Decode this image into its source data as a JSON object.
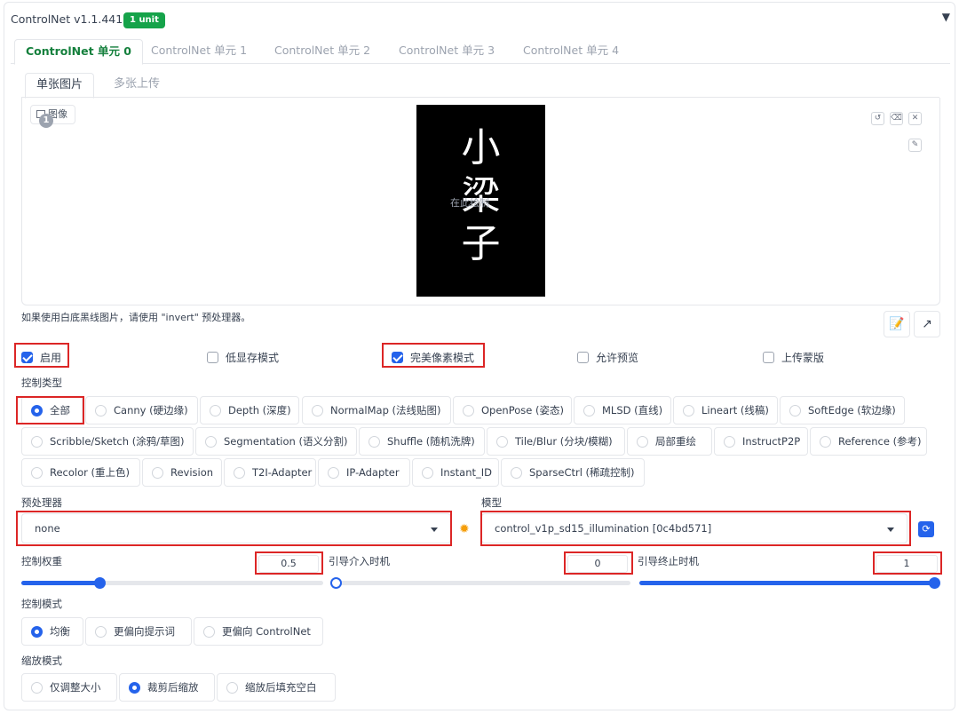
{
  "header": {
    "title": "ControlNet v1.1.441",
    "badge": "1 unit"
  },
  "tabs": [
    "ControlNet 单元 0",
    "ControlNet 单元 1",
    "ControlNet 单元 2",
    "ControlNet 单元 3",
    "ControlNet 单元 4"
  ],
  "subtabs": [
    "单张图片",
    "多张上传"
  ],
  "image": {
    "label": "图像",
    "number": "1",
    "characters": [
      "小",
      "梁",
      "子"
    ],
    "watermark": "在此绘制"
  },
  "hint": "如果使用白底黑线图片，请使用 \"invert\" 预处理器。",
  "options": {
    "enable": "启用",
    "low_vram": "低显存模式",
    "pixel_perfect": "完美像素模式",
    "allow_preview": "允许预览",
    "upload_mask": "上传蒙版"
  },
  "control_type": {
    "label": "控制类型",
    "rows": [
      [
        "全部",
        "Canny (硬边缘)",
        "Depth (深度)",
        "NormalMap (法线贴图)",
        "OpenPose (姿态)",
        "MLSD (直线)",
        "Lineart (线稿)",
        "SoftEdge (软边缘)"
      ],
      [
        "Scribble/Sketch (涂鸦/草图)",
        "Segmentation (语义分割)",
        "Shuffle (随机洗牌)",
        "Tile/Blur (分块/模糊)",
        "局部重绘",
        "InstructP2P",
        "Reference (参考)"
      ],
      [
        "Recolor (重上色)",
        "Revision",
        "T2I-Adapter",
        "IP-Adapter",
        "Instant_ID",
        "SparseCtrl (稀疏控制)"
      ]
    ],
    "selected": "全部"
  },
  "preprocessor": {
    "label": "预处理器",
    "value": "none"
  },
  "model": {
    "label": "模型",
    "value": "control_v1p_sd15_illumination [0c4bd571]"
  },
  "sliders": {
    "weight": {
      "label": "控制权重",
      "value": "0.5",
      "fraction": 0.25
    },
    "start": {
      "label": "引导介入时机",
      "value": "0",
      "fraction": 0
    },
    "end": {
      "label": "引导终止时机",
      "value": "1",
      "fraction": 1
    }
  },
  "control_mode": {
    "label": "控制模式",
    "options": [
      "均衡",
      "更偏向提示词",
      "更偏向 ControlNet"
    ],
    "selected": "均衡"
  },
  "resize_mode": {
    "label": "缩放模式",
    "options": [
      "仅调整大小",
      "裁剪后缩放",
      "缩放后填充空白"
    ],
    "selected": "裁剪后缩放"
  },
  "colors": {
    "accent": "#2563eb",
    "highlight": "#dc2626",
    "active_tab": "#15803d",
    "badge": "#16a34a"
  }
}
